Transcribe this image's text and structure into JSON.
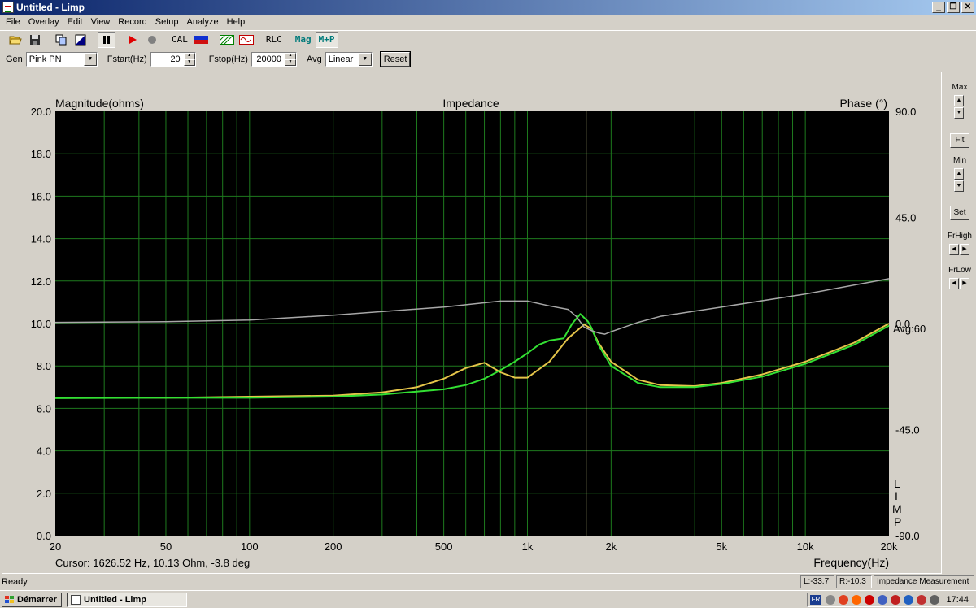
{
  "window": {
    "title": "Untitled - Limp",
    "min_glyph": "_",
    "max_glyph": "❐",
    "close_glyph": "✕"
  },
  "menu": [
    "File",
    "Overlay",
    "Edit",
    "View",
    "Record",
    "Setup",
    "Analyze",
    "Help"
  ],
  "toolbar": {
    "cal_label": "CAL",
    "rlc_label": "RLC",
    "mag_label": "Mag",
    "mp_label": "M+P"
  },
  "settings": {
    "gen_label": "Gen",
    "gen_value": "Pink PN",
    "fstart_label": "Fstart(Hz)",
    "fstart_value": "20",
    "fstop_label": "Fstop(Hz)",
    "fstop_value": "20000",
    "avg_label": "Avg",
    "avg_value": "Linear",
    "reset_label": "Reset"
  },
  "chart": {
    "ylabel_left": "Magnitude(ohms)",
    "title": "Impedance",
    "ylabel_right": "Phase (°)",
    "xlabel": "Frequency(Hz)",
    "avg_text": "Avg:60",
    "limp_letters": [
      "L",
      "I",
      "M",
      "P"
    ],
    "cursor_text": "Cursor: 1626.52 Hz, 10.13 Ohm, -3.8 deg"
  },
  "chart_data": {
    "type": "line",
    "title": "Impedance",
    "xlabel": "Frequency(Hz)",
    "ylabel": "Magnitude(ohms)",
    "y2label": "Phase (°)",
    "x_scale": "log",
    "xlim": [
      20,
      20000
    ],
    "ylim": [
      0,
      20
    ],
    "y2lim": [
      -90,
      90
    ],
    "grid": true,
    "background": "#000000",
    "x_ticks": [
      20,
      50,
      100,
      200,
      500,
      1000,
      2000,
      5000,
      10000,
      20000
    ],
    "x_tick_labels": [
      "20",
      "50",
      "100",
      "200",
      "500",
      "1k",
      "2k",
      "5k",
      "10k",
      "20k"
    ],
    "y_ticks": [
      0,
      2,
      4,
      6,
      8,
      10,
      12,
      14,
      16,
      18,
      20
    ],
    "y_tick_labels": [
      "0.0",
      "2.0",
      "4.0",
      "6.0",
      "8.0",
      "10.0",
      "12.0",
      "14.0",
      "16.0",
      "18.0",
      "20.0"
    ],
    "y2_ticks": [
      90,
      45,
      0,
      -45,
      -90
    ],
    "y2_tick_labels": [
      "90.0",
      "45.0",
      "0.0",
      "-45.0",
      "-90.0"
    ],
    "cursor_x": 1626.52,
    "series": [
      {
        "color": "#e5c54a",
        "axis": "left",
        "x": [
          20,
          50,
          100,
          200,
          300,
          400,
          500,
          600,
          700,
          800,
          900,
          1000,
          1200,
          1400,
          1600,
          1700,
          1800,
          2000,
          2500,
          3000,
          4000,
          5000,
          7000,
          10000,
          15000,
          20000
        ],
        "y": [
          6.5,
          6.5,
          6.55,
          6.6,
          6.75,
          7.0,
          7.4,
          7.9,
          8.15,
          7.7,
          7.45,
          7.45,
          8.2,
          9.3,
          9.95,
          9.75,
          9.1,
          8.2,
          7.35,
          7.1,
          7.05,
          7.2,
          7.6,
          8.2,
          9.1,
          10.0
        ]
      },
      {
        "color": "#33e033",
        "axis": "left",
        "x": [
          20,
          50,
          100,
          200,
          300,
          500,
          600,
          700,
          800,
          900,
          1000,
          1100,
          1200,
          1350,
          1450,
          1550,
          1650,
          1700,
          1800,
          2000,
          2500,
          3000,
          4000,
          5000,
          7000,
          10000,
          15000,
          20000
        ],
        "y": [
          6.48,
          6.5,
          6.5,
          6.55,
          6.65,
          6.9,
          7.1,
          7.4,
          7.8,
          8.2,
          8.6,
          9.0,
          9.2,
          9.3,
          10.0,
          10.45,
          10.1,
          9.8,
          9.0,
          8.0,
          7.2,
          7.0,
          7.0,
          7.15,
          7.5,
          8.1,
          9.0,
          9.9
        ]
      },
      {
        "color": "#a8a8a8",
        "axis": "right",
        "x": [
          20,
          50,
          100,
          200,
          500,
          800,
          1000,
          1200,
          1400,
          1500,
          1600,
          1700,
          1800,
          1900,
          2000,
          2500,
          3000,
          5000,
          10000,
          20000
        ],
        "y": [
          0.5,
          0.8,
          1.5,
          3.5,
          7.0,
          9.5,
          9.5,
          7.5,
          6.0,
          3.0,
          -1.5,
          -3.0,
          -4.0,
          -4.5,
          -3.5,
          0.5,
          3.0,
          7.0,
          12.5,
          19.0
        ]
      }
    ]
  },
  "rightpanel": {
    "max_label": "Max",
    "fit_label": "Fit",
    "min_label": "Min",
    "set_label": "Set",
    "frhigh_label": "FrHigh",
    "frlow_label": "FrLow"
  },
  "status": {
    "ready": "Ready",
    "l_value": "L:-33.7",
    "r_value": "R:-10.3",
    "mode": "Impedance Measurement"
  },
  "taskbar": {
    "start_label": "Démarrer",
    "task_label": "Untitled - Limp",
    "lang": "FR",
    "clock": "17:44"
  }
}
